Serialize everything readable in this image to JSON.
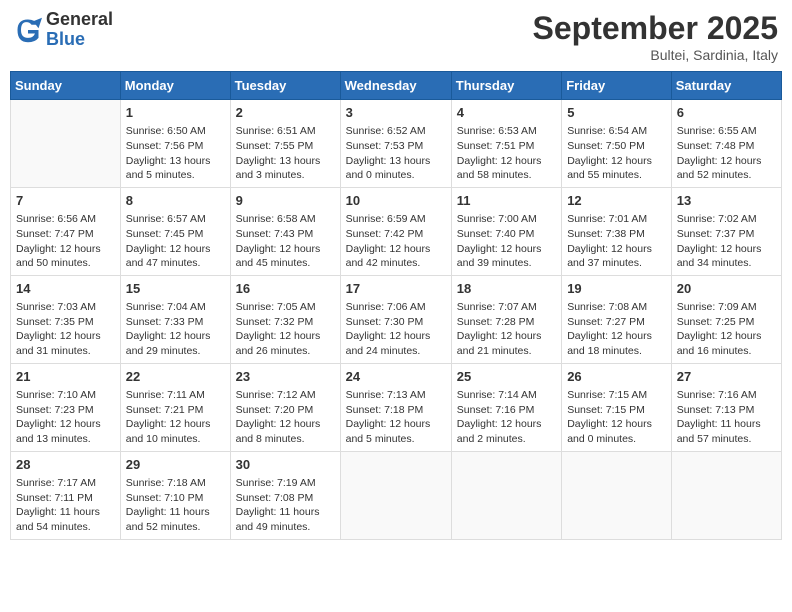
{
  "logo": {
    "line1": "General",
    "line2": "Blue"
  },
  "title": "September 2025",
  "location": "Bultei, Sardinia, Italy",
  "weekdays": [
    "Sunday",
    "Monday",
    "Tuesday",
    "Wednesday",
    "Thursday",
    "Friday",
    "Saturday"
  ],
  "weeks": [
    [
      {
        "day": "",
        "sunrise": "",
        "sunset": "",
        "daylight": ""
      },
      {
        "day": "1",
        "sunrise": "Sunrise: 6:50 AM",
        "sunset": "Sunset: 7:56 PM",
        "daylight": "Daylight: 13 hours and 5 minutes."
      },
      {
        "day": "2",
        "sunrise": "Sunrise: 6:51 AM",
        "sunset": "Sunset: 7:55 PM",
        "daylight": "Daylight: 13 hours and 3 minutes."
      },
      {
        "day": "3",
        "sunrise": "Sunrise: 6:52 AM",
        "sunset": "Sunset: 7:53 PM",
        "daylight": "Daylight: 13 hours and 0 minutes."
      },
      {
        "day": "4",
        "sunrise": "Sunrise: 6:53 AM",
        "sunset": "Sunset: 7:51 PM",
        "daylight": "Daylight: 12 hours and 58 minutes."
      },
      {
        "day": "5",
        "sunrise": "Sunrise: 6:54 AM",
        "sunset": "Sunset: 7:50 PM",
        "daylight": "Daylight: 12 hours and 55 minutes."
      },
      {
        "day": "6",
        "sunrise": "Sunrise: 6:55 AM",
        "sunset": "Sunset: 7:48 PM",
        "daylight": "Daylight: 12 hours and 52 minutes."
      }
    ],
    [
      {
        "day": "7",
        "sunrise": "Sunrise: 6:56 AM",
        "sunset": "Sunset: 7:47 PM",
        "daylight": "Daylight: 12 hours and 50 minutes."
      },
      {
        "day": "8",
        "sunrise": "Sunrise: 6:57 AM",
        "sunset": "Sunset: 7:45 PM",
        "daylight": "Daylight: 12 hours and 47 minutes."
      },
      {
        "day": "9",
        "sunrise": "Sunrise: 6:58 AM",
        "sunset": "Sunset: 7:43 PM",
        "daylight": "Daylight: 12 hours and 45 minutes."
      },
      {
        "day": "10",
        "sunrise": "Sunrise: 6:59 AM",
        "sunset": "Sunset: 7:42 PM",
        "daylight": "Daylight: 12 hours and 42 minutes."
      },
      {
        "day": "11",
        "sunrise": "Sunrise: 7:00 AM",
        "sunset": "Sunset: 7:40 PM",
        "daylight": "Daylight: 12 hours and 39 minutes."
      },
      {
        "day": "12",
        "sunrise": "Sunrise: 7:01 AM",
        "sunset": "Sunset: 7:38 PM",
        "daylight": "Daylight: 12 hours and 37 minutes."
      },
      {
        "day": "13",
        "sunrise": "Sunrise: 7:02 AM",
        "sunset": "Sunset: 7:37 PM",
        "daylight": "Daylight: 12 hours and 34 minutes."
      }
    ],
    [
      {
        "day": "14",
        "sunrise": "Sunrise: 7:03 AM",
        "sunset": "Sunset: 7:35 PM",
        "daylight": "Daylight: 12 hours and 31 minutes."
      },
      {
        "day": "15",
        "sunrise": "Sunrise: 7:04 AM",
        "sunset": "Sunset: 7:33 PM",
        "daylight": "Daylight: 12 hours and 29 minutes."
      },
      {
        "day": "16",
        "sunrise": "Sunrise: 7:05 AM",
        "sunset": "Sunset: 7:32 PM",
        "daylight": "Daylight: 12 hours and 26 minutes."
      },
      {
        "day": "17",
        "sunrise": "Sunrise: 7:06 AM",
        "sunset": "Sunset: 7:30 PM",
        "daylight": "Daylight: 12 hours and 24 minutes."
      },
      {
        "day": "18",
        "sunrise": "Sunrise: 7:07 AM",
        "sunset": "Sunset: 7:28 PM",
        "daylight": "Daylight: 12 hours and 21 minutes."
      },
      {
        "day": "19",
        "sunrise": "Sunrise: 7:08 AM",
        "sunset": "Sunset: 7:27 PM",
        "daylight": "Daylight: 12 hours and 18 minutes."
      },
      {
        "day": "20",
        "sunrise": "Sunrise: 7:09 AM",
        "sunset": "Sunset: 7:25 PM",
        "daylight": "Daylight: 12 hours and 16 minutes."
      }
    ],
    [
      {
        "day": "21",
        "sunrise": "Sunrise: 7:10 AM",
        "sunset": "Sunset: 7:23 PM",
        "daylight": "Daylight: 12 hours and 13 minutes."
      },
      {
        "day": "22",
        "sunrise": "Sunrise: 7:11 AM",
        "sunset": "Sunset: 7:21 PM",
        "daylight": "Daylight: 12 hours and 10 minutes."
      },
      {
        "day": "23",
        "sunrise": "Sunrise: 7:12 AM",
        "sunset": "Sunset: 7:20 PM",
        "daylight": "Daylight: 12 hours and 8 minutes."
      },
      {
        "day": "24",
        "sunrise": "Sunrise: 7:13 AM",
        "sunset": "Sunset: 7:18 PM",
        "daylight": "Daylight: 12 hours and 5 minutes."
      },
      {
        "day": "25",
        "sunrise": "Sunrise: 7:14 AM",
        "sunset": "Sunset: 7:16 PM",
        "daylight": "Daylight: 12 hours and 2 minutes."
      },
      {
        "day": "26",
        "sunrise": "Sunrise: 7:15 AM",
        "sunset": "Sunset: 7:15 PM",
        "daylight": "Daylight: 12 hours and 0 minutes."
      },
      {
        "day": "27",
        "sunrise": "Sunrise: 7:16 AM",
        "sunset": "Sunset: 7:13 PM",
        "daylight": "Daylight: 11 hours and 57 minutes."
      }
    ],
    [
      {
        "day": "28",
        "sunrise": "Sunrise: 7:17 AM",
        "sunset": "Sunset: 7:11 PM",
        "daylight": "Daylight: 11 hours and 54 minutes."
      },
      {
        "day": "29",
        "sunrise": "Sunrise: 7:18 AM",
        "sunset": "Sunset: 7:10 PM",
        "daylight": "Daylight: 11 hours and 52 minutes."
      },
      {
        "day": "30",
        "sunrise": "Sunrise: 7:19 AM",
        "sunset": "Sunset: 7:08 PM",
        "daylight": "Daylight: 11 hours and 49 minutes."
      },
      {
        "day": "",
        "sunrise": "",
        "sunset": "",
        "daylight": ""
      },
      {
        "day": "",
        "sunrise": "",
        "sunset": "",
        "daylight": ""
      },
      {
        "day": "",
        "sunrise": "",
        "sunset": "",
        "daylight": ""
      },
      {
        "day": "",
        "sunrise": "",
        "sunset": "",
        "daylight": ""
      }
    ]
  ]
}
